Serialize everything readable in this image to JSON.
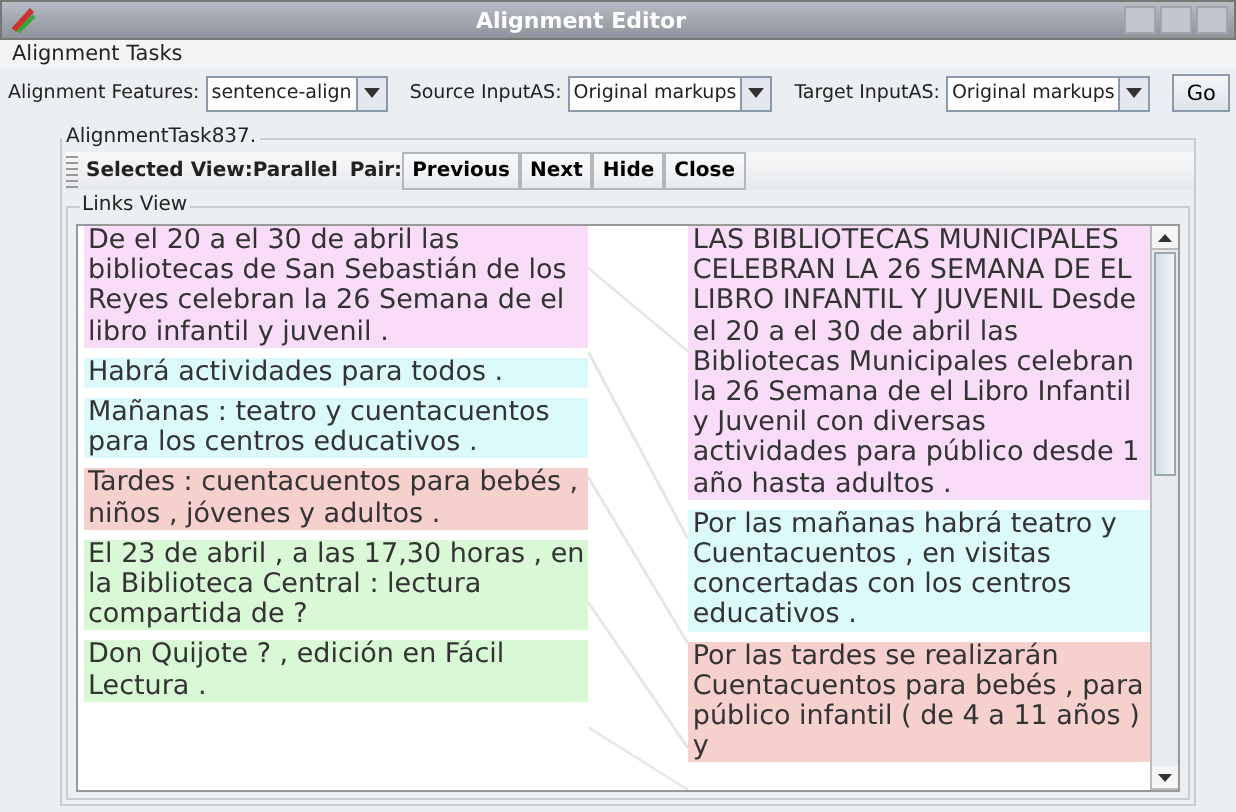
{
  "window": {
    "title": "Alignment Editor"
  },
  "menu": [
    "Alignment Tasks"
  ],
  "toolbar": {
    "features_label": "Alignment Features:",
    "features_value": "sentence-align",
    "source_label": "Source InputAS:",
    "source_value": "Original markups",
    "target_label": "Target InputAS:",
    "target_value": "Original markups",
    "go": "Go"
  },
  "task": {
    "title": "AlignmentTask837.",
    "view_label": "Selected View:Parallel",
    "pair_label": "Pair:",
    "buttons": [
      "Previous",
      "Next",
      "Hide",
      "Close"
    ]
  },
  "links_view": {
    "title": "Links View",
    "source": [
      {
        "text": "De el 20 a el 30 de abril las bibliotecas de San Sebastián de los Reyes celebran la 26 Semana de el libro infantil y juvenil .",
        "color": "#f9dcf7"
      },
      {
        "text": "Habrá actividades para todos .",
        "color": "#dcfafc"
      },
      {
        "text": "Mañanas : teatro y cuentacuentos para los centros educativos .",
        "color": "#dcfafc"
      },
      {
        "text": "Tardes : cuentacuentos para bebés , niños , jóvenes y adultos .",
        "color": "#f6d0cd"
      },
      {
        "text": "El 23 de abril , a las 17,30 horas , en la Biblioteca Central : lectura compartida de ?",
        "color": "#d9f8d5"
      },
      {
        "text": "Don Quijote ? , edición en Fácil Lectura .",
        "color": "#d9f8d5"
      }
    ],
    "target": [
      {
        "text": "LAS BIBLIOTECAS MUNICIPALES CELEBRAN LA 26 SEMANA DE EL LIBRO INFANTIL Y JUVENIL Desde el 20 a el 30 de abril las Bibliotecas Municipales celebran la 26 Semana de el Libro Infantil y Juvenil con diversas actividades para público desde 1 año hasta adultos .",
        "color": "#f9dcf7"
      },
      {
        "text": "Por las mañanas habrá teatro y Cuentacuentos , en visitas concertadas con los centros educativos .",
        "color": "#dcfafc"
      },
      {
        "text": "Por las tardes se realizarán Cuentacuentos para bebés , para público infantil ( de 4 a 11 años ) y",
        "color": "#f6d0cd"
      }
    ]
  }
}
